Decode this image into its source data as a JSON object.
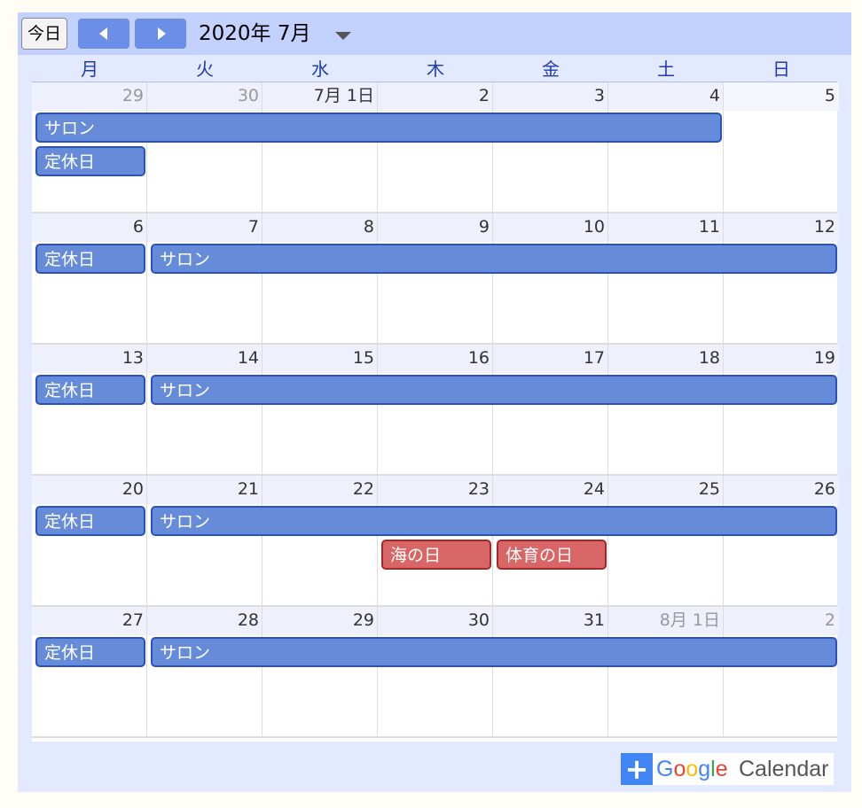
{
  "toolbar": {
    "today_label": "今日",
    "title": "2020年 7月"
  },
  "weekdays": [
    "月",
    "火",
    "水",
    "木",
    "金",
    "土",
    "日"
  ],
  "weeks": [
    {
      "days": [
        {
          "label": "29",
          "other": true
        },
        {
          "label": "30",
          "other": true
        },
        {
          "label": "7月 1日",
          "other": false
        },
        {
          "label": "2",
          "other": false
        },
        {
          "label": "3",
          "other": false
        },
        {
          "label": "4",
          "other": false
        },
        {
          "label": "5",
          "other": false
        }
      ]
    },
    {
      "days": [
        {
          "label": "6",
          "other": false
        },
        {
          "label": "7",
          "other": false
        },
        {
          "label": "8",
          "other": false
        },
        {
          "label": "9",
          "other": false
        },
        {
          "label": "10",
          "other": false
        },
        {
          "label": "11",
          "other": false
        },
        {
          "label": "12",
          "other": false
        }
      ]
    },
    {
      "days": [
        {
          "label": "13",
          "other": false
        },
        {
          "label": "14",
          "other": false
        },
        {
          "label": "15",
          "other": false
        },
        {
          "label": "16",
          "other": false
        },
        {
          "label": "17",
          "other": false
        },
        {
          "label": "18",
          "other": false
        },
        {
          "label": "19",
          "other": false
        }
      ]
    },
    {
      "days": [
        {
          "label": "20",
          "other": false
        },
        {
          "label": "21",
          "other": false
        },
        {
          "label": "22",
          "other": false
        },
        {
          "label": "23",
          "other": false
        },
        {
          "label": "24",
          "other": false
        },
        {
          "label": "25",
          "other": false
        },
        {
          "label": "26",
          "other": false
        }
      ]
    },
    {
      "days": [
        {
          "label": "27",
          "other": false
        },
        {
          "label": "28",
          "other": false
        },
        {
          "label": "29",
          "other": false
        },
        {
          "label": "30",
          "other": false
        },
        {
          "label": "31",
          "other": false
        },
        {
          "label": "8月 1日",
          "other": true
        },
        {
          "label": "2",
          "other": true
        }
      ]
    }
  ],
  "events": [
    {
      "title": "サロン",
      "week": 0,
      "start": 0,
      "span": 6,
      "lane": 0,
      "color": "blue"
    },
    {
      "title": "定休日",
      "week": 0,
      "start": 0,
      "span": 1,
      "lane": 1,
      "color": "blue"
    },
    {
      "title": "定休日",
      "week": 1,
      "start": 0,
      "span": 1,
      "lane": 0,
      "color": "blue"
    },
    {
      "title": "サロン",
      "week": 1,
      "start": 1,
      "span": 6,
      "lane": 0,
      "color": "blue"
    },
    {
      "title": "定休日",
      "week": 2,
      "start": 0,
      "span": 1,
      "lane": 0,
      "color": "blue"
    },
    {
      "title": "サロン",
      "week": 2,
      "start": 1,
      "span": 6,
      "lane": 0,
      "color": "blue"
    },
    {
      "title": "定休日",
      "week": 3,
      "start": 0,
      "span": 1,
      "lane": 0,
      "color": "blue"
    },
    {
      "title": "サロン",
      "week": 3,
      "start": 1,
      "span": 6,
      "lane": 0,
      "color": "blue"
    },
    {
      "title": "海の日",
      "week": 3,
      "start": 3,
      "span": 1,
      "lane": 1,
      "color": "red"
    },
    {
      "title": "体育の日",
      "week": 3,
      "start": 4,
      "span": 1,
      "lane": 1,
      "color": "red"
    },
    {
      "title": "定休日",
      "week": 4,
      "start": 0,
      "span": 1,
      "lane": 0,
      "color": "blue"
    },
    {
      "title": "サロン",
      "week": 4,
      "start": 1,
      "span": 6,
      "lane": 0,
      "color": "blue"
    }
  ],
  "footer": {
    "google_text": "Google",
    "calendar_text": "Calendar",
    "plus_symbol": "+"
  },
  "colors": {
    "event_blue": "#668cd9",
    "event_red": "#d96666",
    "header_bg": "#c3d1ff",
    "weekday_text": "#1f3bb3"
  }
}
